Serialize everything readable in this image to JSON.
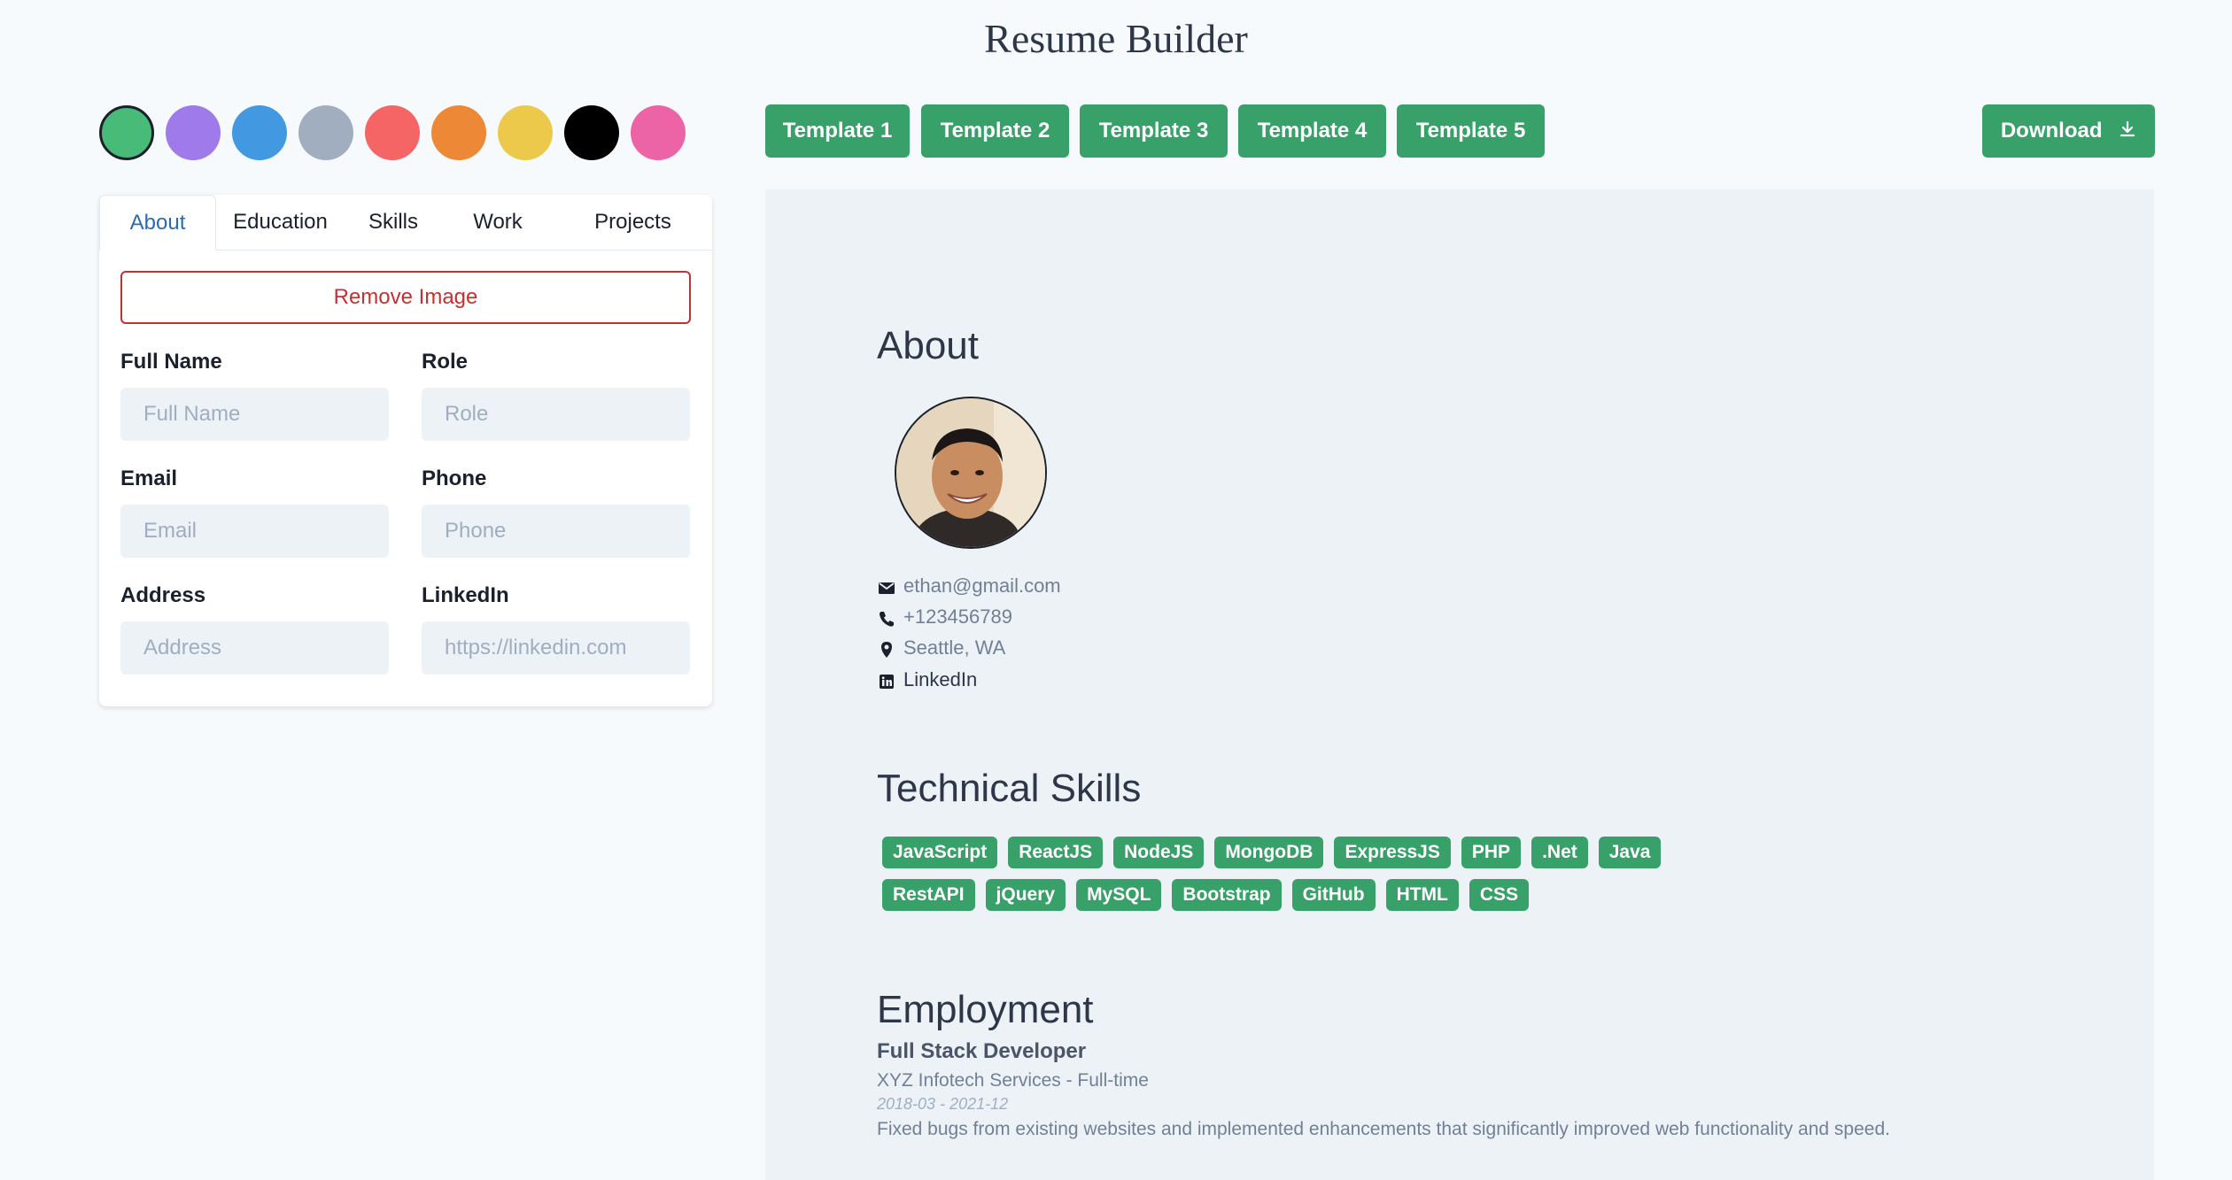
{
  "app": {
    "title": "Resume Builder"
  },
  "swatches": [
    {
      "name": "green",
      "color": "#48bb78",
      "selected": true
    },
    {
      "name": "purple",
      "color": "#9f7aea"
    },
    {
      "name": "blue",
      "color": "#4299e1"
    },
    {
      "name": "gray",
      "color": "#a0aec0"
    },
    {
      "name": "red",
      "color": "#f56565"
    },
    {
      "name": "orange",
      "color": "#ed8936"
    },
    {
      "name": "yellow",
      "color": "#ecc94b"
    },
    {
      "name": "black",
      "color": "#000000"
    },
    {
      "name": "pink",
      "color": "#ed64a6"
    }
  ],
  "tabs": {
    "about": "About",
    "education": "Education",
    "skills": "Skills",
    "work": "Work",
    "projects": "Projects",
    "active": "About"
  },
  "form": {
    "remove_image": "Remove Image",
    "full_name": {
      "label": "Full Name",
      "placeholder": "Full Name",
      "value": ""
    },
    "role": {
      "label": "Role",
      "placeholder": "Role",
      "value": ""
    },
    "email": {
      "label": "Email",
      "placeholder": "Email",
      "value": ""
    },
    "phone": {
      "label": "Phone",
      "placeholder": "Phone",
      "value": ""
    },
    "address": {
      "label": "Address",
      "placeholder": "Address",
      "value": ""
    },
    "linkedin": {
      "label": "LinkedIn",
      "placeholder": "https://linkedin.com",
      "value": ""
    }
  },
  "templates": [
    "Template 1",
    "Template 2",
    "Template 3",
    "Template 4",
    "Template 5"
  ],
  "download": {
    "label": "Download",
    "icon": "download-icon"
  },
  "colors": {
    "accent": "#38a169",
    "danger": "#c53030",
    "active_tab": "#2b6cb0"
  },
  "preview": {
    "about_title": "About",
    "avatar_icon": "profile-photo",
    "contact": {
      "email": "ethan@gmail.com",
      "phone": "+123456789",
      "address": "Seattle, WA",
      "linkedin": "LinkedIn"
    },
    "skills_title": "Technical Skills",
    "skills": [
      "JavaScript",
      "ReactJS",
      "NodeJS",
      "MongoDB",
      "ExpressJS",
      "PHP",
      ".Net",
      "Java",
      "RestAPI",
      "jQuery",
      "MySQL",
      "Bootstrap",
      "GitHub",
      "HTML",
      "CSS"
    ],
    "employment_title": "Employment",
    "job": {
      "title": "Full Stack Developer",
      "company": "XYZ Infotech Services - Full-time",
      "dates": "2018-03 - 2021-12",
      "description": "Fixed bugs from existing websites and implemented enhancements that significantly improved web functionality and speed."
    }
  }
}
